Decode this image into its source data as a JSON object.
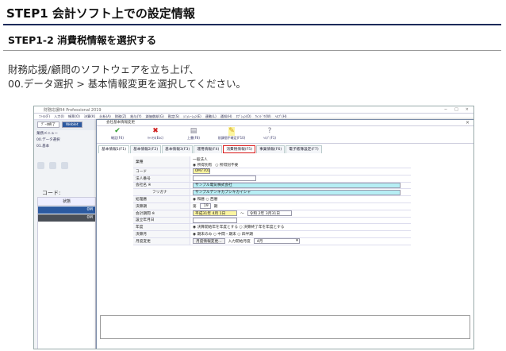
{
  "slide": {
    "title": "STEP1 会計ソフト上での設定情報",
    "subheading": "STEP1-2 消費税情報を選択する",
    "line1": "財務応援/顧問のソフトウェアを立ち上げ、",
    "line2": "00.データ選択 > 基本情報変更を選択してください。"
  },
  "app": {
    "title": "財務応援R4 Professional 2019",
    "win_controls": [
      "−",
      "□",
      "×"
    ],
    "menu": [
      "ﾌｧｲﾙ(F)",
      "入力(I)",
      "帳票(O)",
      "決算(K)",
      "分析(A)",
      "財務(Z)",
      "給与(Y)",
      "減価償却(G)",
      "勘定(S)",
      "ｼﾐｭﾚｰｼｮﾝ(E)",
      "連動(L)",
      "通知(H)",
      "ｵﾌﾟｼｮﾝ(O)",
      "ｳｨﾝﾄﾞｳ(W)",
      "ﾍﾙﾌﾟ(H)"
    ],
    "tabs": [
      "ﾃﾞｰﾀ終了",
      "Weblet"
    ],
    "left_menu": [
      "業務メニュー",
      "00.データ選択",
      "01.基本"
    ],
    "left_code_label": "コード:",
    "grid_header": "状態",
    "grid_rows": [
      "0M",
      "0M"
    ]
  },
  "dialog": {
    "title": "会社基本情報変更",
    "close": "×",
    "toolbar": [
      {
        "label": "確定(F4)",
        "icon": "✔",
        "icon_name": "check-icon"
      },
      {
        "label": "ｷｬﾝｾﾙ(Esc)",
        "icon": "✖",
        "icon_name": "cancel-icon"
      },
      {
        "label": "上書(F8)",
        "icon": "▤",
        "icon_name": "overwrite-icon"
      },
      {
        "label": "前課個不確定(F10)",
        "icon": "✎",
        "icon_name": "edit-icon"
      },
      {
        "label": "ﾍﾙﾌﾟ(F1)",
        "icon": "?",
        "icon_name": "help-icon"
      }
    ],
    "tabs": [
      "基本情報1(F1)",
      "基本情報2(F2)",
      "基本情報3(F3)",
      "運用情報(F4)",
      "消費税情報(F5)",
      "事業情報(F6)",
      "電子帳簿設定(F7)"
    ],
    "highlight_tab": "消費税情報(F5)",
    "form": {
      "gyoshu_label": "業種",
      "gyoshu_top": "一般法人",
      "gyoshu_radio1": "◉ 所得別有",
      "gyoshu_radio2": "○ 所得別不要",
      "code_label": "コード",
      "code_value": "0M7701",
      "houjin_label": "法人番号",
      "company_label": "会社名 ※",
      "company_value": "サンプル電気株式会社",
      "furigana_label": "フリガナ",
      "furigana_value": "サンプルデンキカブシキカイシャ",
      "reki_label": "処理暦",
      "reki_value": "◉ 和暦  ○ 西暦",
      "kessanki_label": "決算期",
      "kessanki_prefix": "第",
      "kessanki_num": "19",
      "kessanki_suffix": "期",
      "kikan_label": "会計期間 ※",
      "kikan_from": "平成31年 4月 1日",
      "kikan_tilde": "〜",
      "kikan_to": "令和 2年 3月31日",
      "setsuritsu_label": "設立年月日",
      "nendo_label": "年度",
      "nendo_value": "◉ 決算開始年を年度とする  ○ 決算終了年を年度とする",
      "kessangetsu_label": "決算月",
      "kessangetsu_value": "◉ 期末のみ  ○ 中間・期末  ○ 四半期",
      "getsudo_label": "月度変更",
      "getsudo_button": "月度情報変更...",
      "getsudo_start_label": "入力開始月度",
      "getsudo_start_value": "4月"
    }
  }
}
